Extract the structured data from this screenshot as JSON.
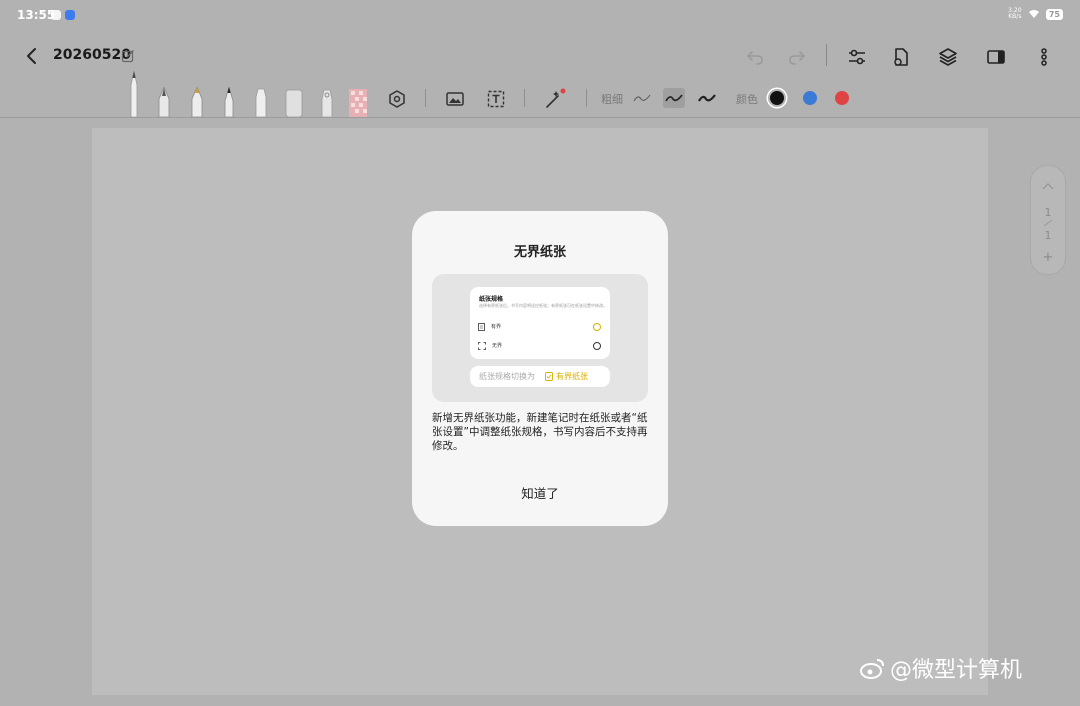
{
  "status_bar": {
    "time": "13:55",
    "network_speed": "3.20 KB/s",
    "battery": "75"
  },
  "header": {
    "title": "20260520"
  },
  "toolbar": {
    "thickness_label": "粗细",
    "color_label": "颜色",
    "colors": [
      "#111111",
      "#3a7bd5",
      "#e04343"
    ]
  },
  "pager": {
    "current": "1",
    "total": "1",
    "add": "+"
  },
  "dialog": {
    "title": "无界纸张",
    "preview": {
      "card_title": "纸张规格",
      "card_desc": "选择有界纸张后，书写内容将适应纸张；有界纸张可在纸张设置中修改。",
      "option_bounded": "有界",
      "option_unbounded": "无界",
      "switch_text": "纸张规格切换为",
      "switch_chip": "有界纸张"
    },
    "body": "新增无界纸张功能，新建笔记时在纸张或者“纸张设置”中调整纸张规格，书写内容后不支持再修改。",
    "confirm": "知道了"
  },
  "watermark": {
    "text": "@微型计算机"
  }
}
